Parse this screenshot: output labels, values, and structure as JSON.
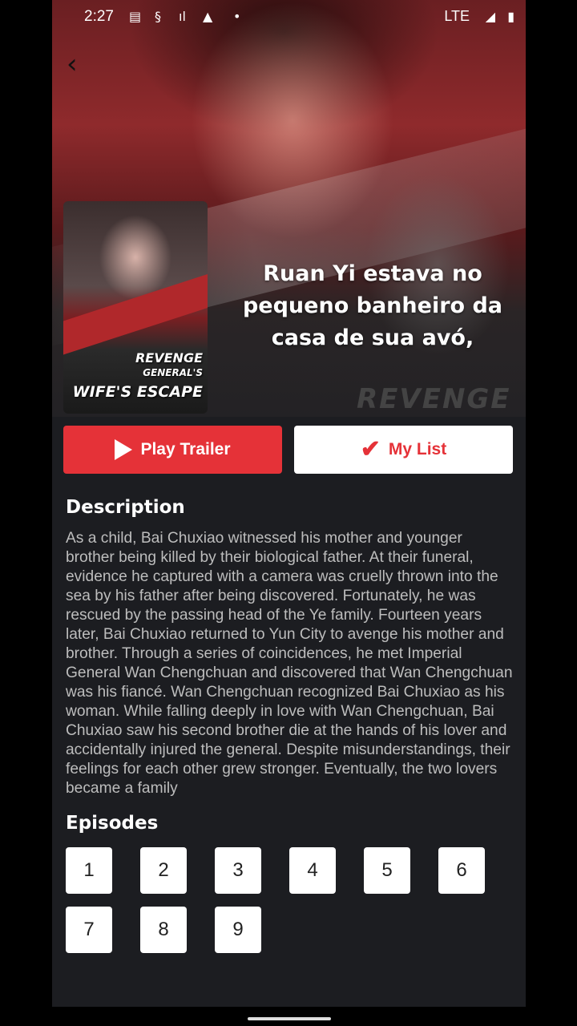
{
  "status_bar": {
    "time": "2:27",
    "network": "LTE"
  },
  "hero": {
    "caption": "Ruan Yi estava no pequeno banheiro da casa de sua avó,",
    "poster": {
      "title_line1": "REVENGE",
      "title_line2": "GENERAL'S",
      "title_line3": "WIFE'S ESCAPE"
    },
    "background_text": "REVENGE"
  },
  "actions": {
    "play_trailer": "Play Trailer",
    "my_list": "My List"
  },
  "description": {
    "heading": "Description",
    "text": "As a child, Bai Chuxiao witnessed his mother and younger brother being killed by their biological father. At their funeral, evidence he captured with a camera was cruelly thrown into the sea by his father after being discovered. Fortunately, he was rescued by the passing head of the Ye family. Fourteen years later, Bai Chuxiao returned to Yun City to avenge his mother and brother. Through a series of coincidences, he met Imperial General Wan Chengchuan and discovered that Wan Chengchuan was his fiancé. Wan Chengchuan recognized Bai Chuxiao as his woman. While falling deeply in love with Wan Chengchuan, Bai Chuxiao saw his second brother die at the hands of his lover and accidentally injured the general. Despite misunderstandings, their feelings for each other grew stronger. Eventually, the two lovers became a family"
  },
  "episodes": {
    "heading": "Episodes",
    "items": [
      "1",
      "2",
      "3",
      "4",
      "5",
      "6",
      "7",
      "8",
      "9"
    ]
  },
  "colors": {
    "accent": "#e53238",
    "background": "#1c1d21"
  }
}
